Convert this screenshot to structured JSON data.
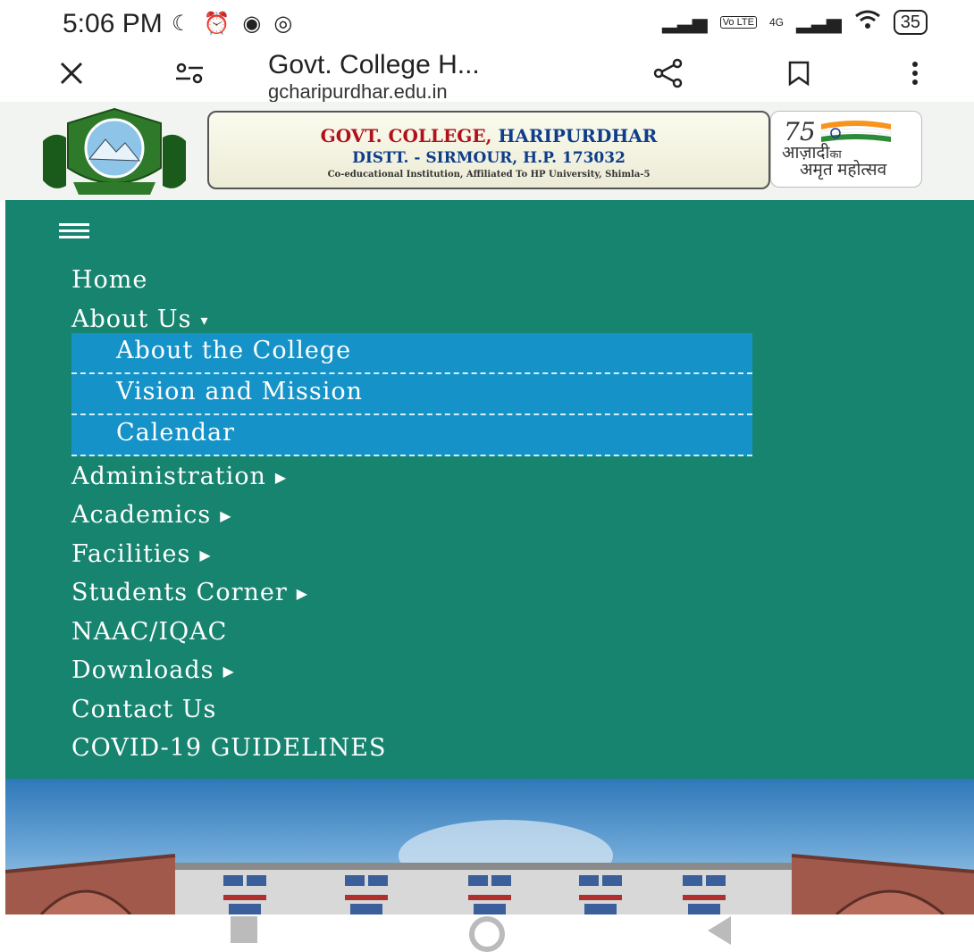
{
  "status_bar": {
    "time": "5:06 PM",
    "battery": "35",
    "network_small": "4G",
    "volte": "Vo LTE"
  },
  "browser": {
    "title": "Govt. College H...",
    "url": "gcharipurdhar.edu.in",
    "icons": [
      "close-icon",
      "site-settings-icon",
      "share-icon",
      "bookmark-icon",
      "more-icon"
    ]
  },
  "header": {
    "college_name_a": "GOVT. COLLEGE,",
    "college_name_b": " HARIPURDHAR",
    "district": "DISTT. - SIRMOUR, H.P. 173032",
    "affiliation": "Co-educational Institution, Affiliated To HP University, Shimla-5",
    "azadi_line1": "आज़ादी",
    "azadi_ka": "का",
    "azadi_line2": "अमृत महोत्सव",
    "azadi_number": "75",
    "colors": {
      "name_red": "#b0121b",
      "name_blue": "#0e3d8a"
    }
  },
  "nav": {
    "background": "#17846f",
    "items": [
      {
        "label": "Home",
        "has_submenu": false
      },
      {
        "label": "About Us",
        "has_submenu": true,
        "expanded": true
      },
      {
        "label": "Administration",
        "has_submenu": true
      },
      {
        "label": "Academics",
        "has_submenu": true
      },
      {
        "label": "Facilities",
        "has_submenu": true
      },
      {
        "label": "Students Corner",
        "has_submenu": true
      },
      {
        "label": "NAAC/IQAC",
        "has_submenu": false
      },
      {
        "label": "Downloads",
        "has_submenu": true
      },
      {
        "label": "Contact Us",
        "has_submenu": false
      },
      {
        "label": "COVID-19 GUIDELINES",
        "has_submenu": false
      }
    ],
    "about_submenu": [
      "About the College",
      "Vision and Mission",
      "Calendar"
    ],
    "submenu_background": "#1593c8"
  }
}
